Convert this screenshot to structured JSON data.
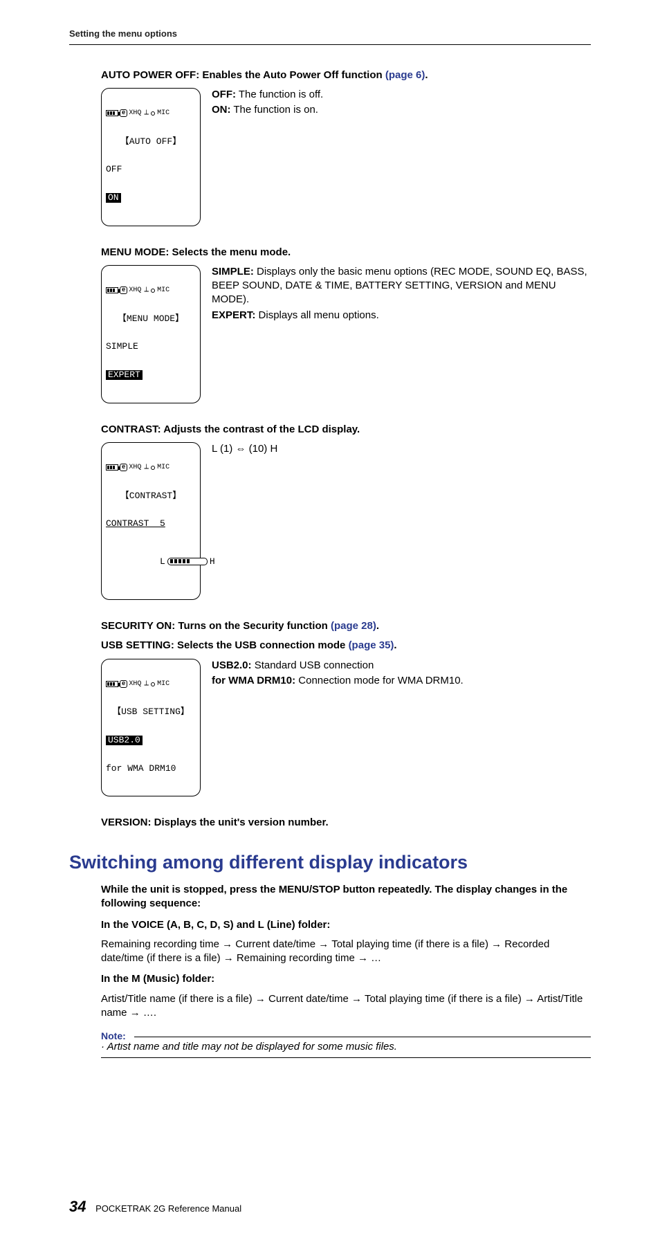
{
  "running_head": "Setting the menu options",
  "auto_power_off": {
    "heading_prefix": "AUTO POWER OFF: Enables the Auto Power Off function ",
    "heading_link": "(page 6)",
    "heading_suffix": ".",
    "lcd": {
      "title": "【AUTO OFF】",
      "line1": "OFF",
      "line2_inv": "ON"
    },
    "opts": [
      {
        "label": "OFF:",
        "text": " The function is off."
      },
      {
        "label": "ON:",
        "text": " The function is on."
      }
    ]
  },
  "menu_mode": {
    "heading": "MENU MODE: Selects the menu mode.",
    "lcd": {
      "title": "【MENU MODE】",
      "line1": "SIMPLE",
      "line2_inv": "EXPERT"
    },
    "opts": [
      {
        "label": "SIMPLE:",
        "text": " Displays only the basic menu options (REC MODE, SOUND EQ, BASS, BEEP SOUND, DATE & TIME, BATTERY SETTING, VERSION and MENU MODE)."
      },
      {
        "label": "EXPERT:",
        "text": " Displays all menu options."
      }
    ]
  },
  "contrast": {
    "heading": "CONTRAST: Adjusts the contrast of the LCD display.",
    "lcd": {
      "title": "【CONTRAST】",
      "line1": "CONTRAST  5",
      "barL": "L",
      "barR": "H"
    },
    "opt_text": "L (1) ⇔ (10) H"
  },
  "security": {
    "heading_prefix": "SECURITY ON: Turns on the Security function ",
    "heading_link": "(page 28)",
    "heading_suffix": "."
  },
  "usb_setting": {
    "heading_prefix": "USB SETTING: Selects the USB connection mode ",
    "heading_link": "(page 35)",
    "heading_suffix": ".",
    "lcd": {
      "title": "【USB SETTING】",
      "line1_inv": "USB2.0",
      "line2": "for WMA DRM10"
    },
    "opts": [
      {
        "label": "USB2.0:",
        "text": " Standard USB connection"
      },
      {
        "label": "for WMA DRM10:",
        "text": " Connection mode for WMA DRM10."
      }
    ]
  },
  "version": {
    "heading": "VERSION: Displays the unit's version number."
  },
  "switching": {
    "heading": "Switching among different display indicators",
    "intro": "While the unit is stopped, press the MENU/STOP button repeatedly. The display changes in the following sequence:",
    "voice_head": "In the VOICE (A, B, C, D, S) and L (Line) folder:",
    "voice_body": "Remaining recording time → Current date/time → Total playing time (if there is a file) → Recorded date/time (if there is a file) → Remaining recording time → …",
    "music_head": "In the M (Music) folder:",
    "music_body": "Artist/Title name (if there is a file) → Current date/time → Total playing time (if there is a file) → Artist/Title name → ….",
    "note_label": "Note:",
    "note_body": "· Artist name and title may not be displayed for some music files."
  },
  "status_bar": {
    "xhq": "XHQ",
    "mic": "MIC"
  },
  "footer": {
    "page": "34",
    "title": "POCKETRAK 2G   Reference Manual"
  }
}
